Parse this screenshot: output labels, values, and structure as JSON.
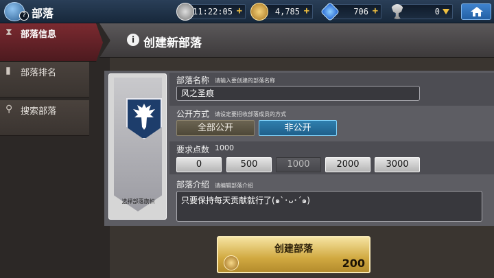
{
  "topbar": {
    "title": "部落",
    "help_badge": "?",
    "timer": {
      "count": "1",
      "time": "1:22:05"
    },
    "coins": "4,785",
    "gems": "706",
    "trophy": "0",
    "plus": "+"
  },
  "sidebar": {
    "items": [
      {
        "label": "部落信息",
        "icon": "hourglass-icon"
      },
      {
        "label": "部落排名",
        "icon": "ranking-icon"
      },
      {
        "label": "搜索部落",
        "icon": "search-icon"
      }
    ]
  },
  "header": {
    "info_icon": "i",
    "title": "创建新部落"
  },
  "banner": {
    "label": "选择部落旗帜"
  },
  "form": {
    "name_label": "部落名称",
    "name_hint": "请输入要创建的部落名称",
    "name_value": "风之圣痕",
    "visibility_label": "公开方式",
    "visibility_hint": "请设定要招收部落成员的方式",
    "visibility_options": [
      "全部公开",
      "非公开"
    ],
    "visibility_selected": "非公开",
    "points_label": "要求点数",
    "points_value": "1000",
    "points_options": [
      "0",
      "500",
      "1000",
      "2000",
      "3000"
    ],
    "intro_label": "部落介绍",
    "intro_hint": "请编辑部落介绍",
    "intro_value": "只要保持每天贡献就行了(๑`･ᴗ･´๑)"
  },
  "create": {
    "label": "创建部落",
    "cost": "200"
  },
  "colors": {
    "accent": "#d1a941",
    "active_tab": "#7b2a30",
    "selected_toggle": "#2f7fae"
  }
}
